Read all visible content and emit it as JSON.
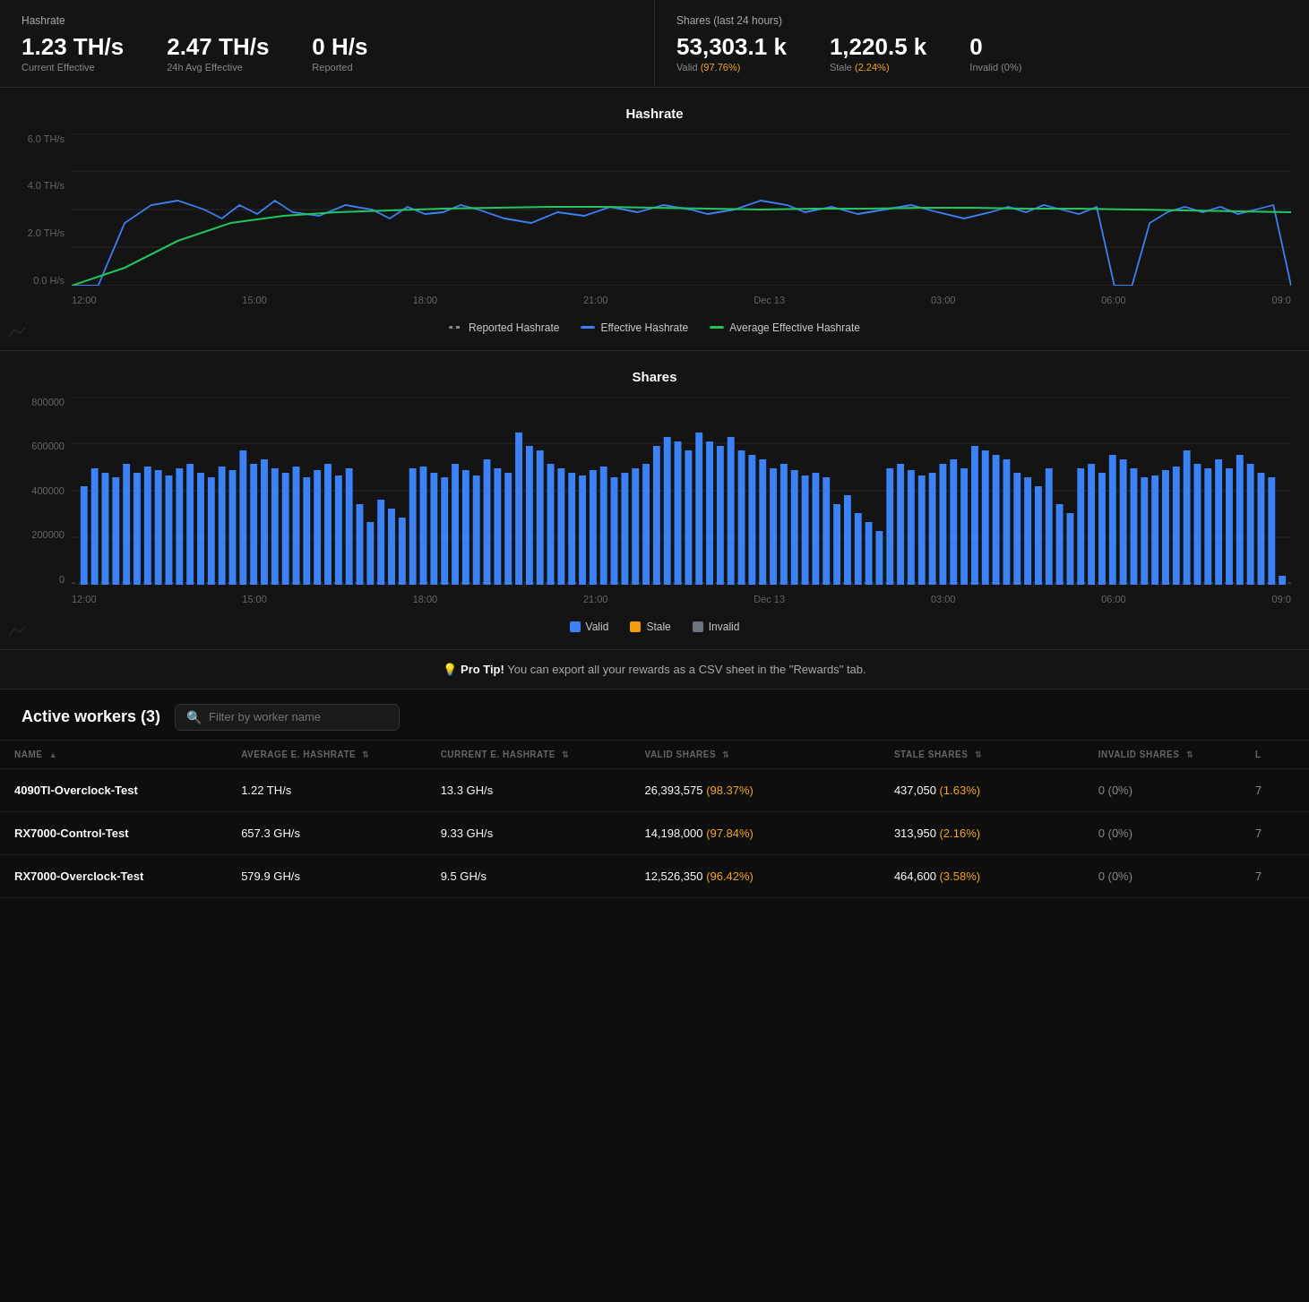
{
  "stats": {
    "hashrate_title": "Hashrate",
    "current_effective_value": "1.23 TH/s",
    "current_effective_label": "Current Effective",
    "avg_24h_value": "2.47 TH/s",
    "avg_24h_label": "24h Avg Effective",
    "reported_value": "0 H/s",
    "reported_label": "Reported",
    "shares_title": "Shares (last 24 hours)",
    "valid_value": "53,303.1 k",
    "valid_label": "Valid",
    "valid_pct": "(97.76%)",
    "stale_value": "1,220.5 k",
    "stale_label": "Stale",
    "stale_pct": "(2.24%)",
    "invalid_value": "0",
    "invalid_label": "Invalid (0%)"
  },
  "hashrate_chart": {
    "title": "Hashrate",
    "y_labels": [
      "6.0 TH/s",
      "4.0 TH/s",
      "2.0 TH/s",
      "0.0 H/s"
    ],
    "x_labels": [
      "12:00",
      "15:00",
      "18:00",
      "21:00",
      "Dec 13",
      "03:00",
      "06:00",
      "09:0"
    ],
    "legend": {
      "reported": "Reported Hashrate",
      "effective": "Effective Hashrate",
      "avg_effective": "Average Effective Hashrate"
    }
  },
  "shares_chart": {
    "title": "Shares",
    "y_labels": [
      "800000",
      "600000",
      "400000",
      "200000",
      "0"
    ],
    "x_labels": [
      "12:00",
      "15:00",
      "18:00",
      "21:00",
      "Dec 13",
      "03:00",
      "06:00",
      "09:0"
    ],
    "legend": {
      "valid": "Valid",
      "stale": "Stale",
      "invalid": "Invalid"
    }
  },
  "pro_tip": {
    "label": "Pro Tip!",
    "message": " You can export all your rewards as a CSV sheet in the \"Rewards\" tab."
  },
  "workers": {
    "title": "Active workers (3)",
    "filter_placeholder": "Filter by worker name",
    "table": {
      "columns": [
        "NAME",
        "AVERAGE E. HASHRATE",
        "CURRENT E. HASHRATE",
        "VALID SHARES",
        "STALE SHARES",
        "INVALID SHARES",
        "L"
      ],
      "rows": [
        {
          "name": "4090TI-Overclock-Test",
          "avg_hashrate": "1.22  TH/s",
          "cur_hashrate": "13.3  GH/s",
          "valid_shares": "26,393,575",
          "valid_pct": "(98.37%)",
          "stale_shares": "437,050",
          "stale_pct": "(1.63%)",
          "invalid_shares": "0",
          "invalid_pct": "(0%)",
          "last": "7"
        },
        {
          "name": "RX7000-Control-Test",
          "avg_hashrate": "657.3  GH/s",
          "cur_hashrate": "9.33  GH/s",
          "valid_shares": "14,198,000",
          "valid_pct": "(97.84%)",
          "stale_shares": "313,950",
          "stale_pct": "(2.16%)",
          "invalid_shares": "0",
          "invalid_pct": "(0%)",
          "last": "7"
        },
        {
          "name": "RX7000-Overclock-Test",
          "avg_hashrate": "579.9  GH/s",
          "cur_hashrate": "9.5  GH/s",
          "valid_shares": "12,526,350",
          "valid_pct": "(96.42%)",
          "stale_shares": "464,600",
          "stale_pct": "(3.58%)",
          "invalid_shares": "0",
          "invalid_pct": "(0%)",
          "last": "7"
        }
      ]
    }
  },
  "colors": {
    "blue": "#3b82f6",
    "green": "#22c55e",
    "gray": "#888888",
    "orange": "#f5a623",
    "bg": "#141414",
    "border": "#2a2a2a"
  }
}
